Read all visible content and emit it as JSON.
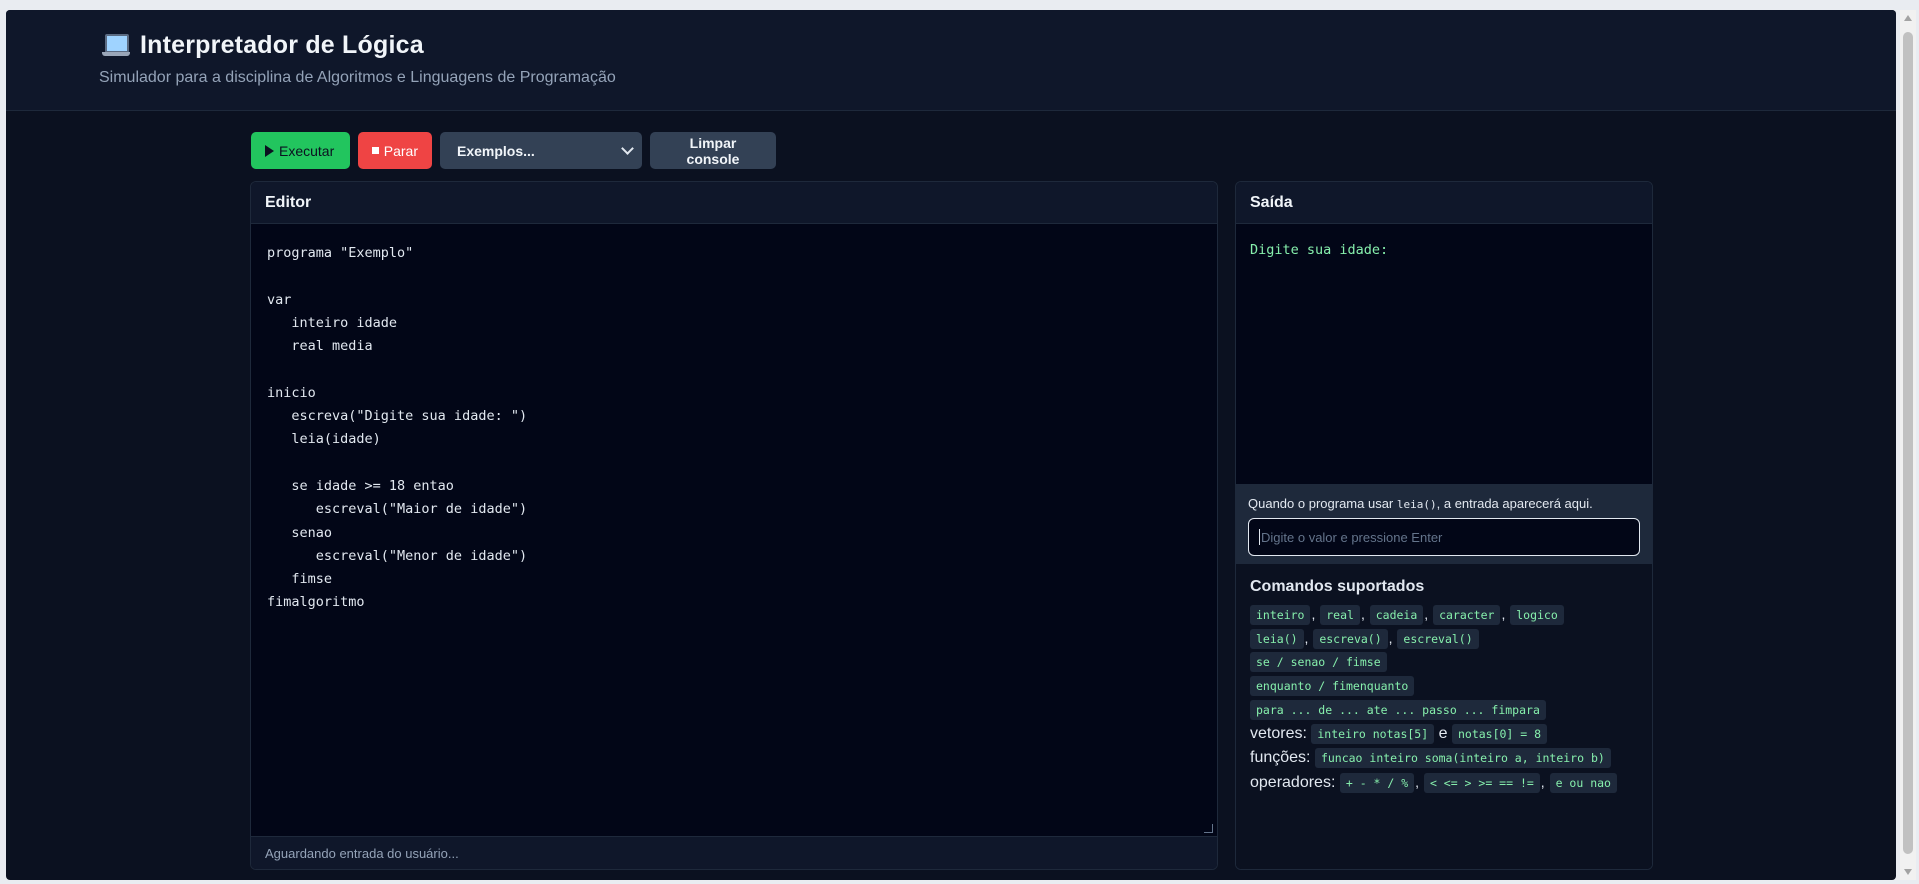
{
  "header": {
    "title": "Interpretador de Lógica",
    "subtitle": "Simulador para a disciplina de Algoritmos e Linguagens de Programação",
    "icon": "laptop-icon"
  },
  "toolbar": {
    "run_label": "Executar",
    "stop_label": "Parar",
    "examples_selected": "Exemplos...",
    "clear_label": "Limpar console"
  },
  "editor": {
    "title": "Editor",
    "code": "programa \"Exemplo\"\n\nvar\n   inteiro idade\n   real media\n\ninicio\n   escreva(\"Digite sua idade: \")\n   leia(idade)\n\n   se idade >= 18 entao\n      escreval(\"Maior de idade\")\n   senao\n      escreval(\"Menor de idade\")\n   fimse\nfimalgoritmo",
    "status": "Aguardando entrada do usuário..."
  },
  "output": {
    "title": "Saída",
    "console_text": "Digite sua idade:",
    "hint_prefix": "Quando o programa usar ",
    "hint_code": "leia()",
    "hint_suffix": ", a entrada aparecerá aqui.",
    "input_placeholder": "Digite o valor e pressione Enter"
  },
  "commands": {
    "title": "Comandos suportados",
    "types": [
      "inteiro",
      "real",
      "cadeia",
      "caracter",
      "logico"
    ],
    "io": [
      "leia()",
      "escreva()",
      "escreval()"
    ],
    "conditional": "se / senao / fimse",
    "while_loop": "enquanto / fimenquanto",
    "for_loop": "para ... de ... ate ... passo ... fimpara",
    "vectors_label": "vetores:",
    "vectors_decl": "inteiro notas[5]",
    "vectors_conj": "e",
    "vectors_assign": "notas[0] = 8",
    "functions_label": "funções:",
    "functions_example": "funcao inteiro soma(inteiro a, inteiro b)",
    "operators_label": "operadores:",
    "operators": [
      "+ - * / %",
      "< <= > >= == !=",
      "e ou nao"
    ]
  },
  "colors": {
    "background": "#0b1120",
    "panel": "#020617",
    "run": "#22c55e",
    "stop": "#ef4444",
    "accent_text": "#86efac"
  }
}
